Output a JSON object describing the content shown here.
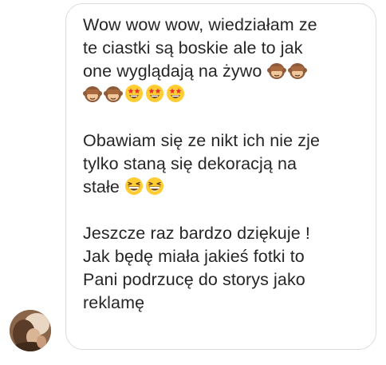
{
  "thread": {
    "message": {
      "paragraphs": [
        {
          "lines": [
            "Wow wow wow, wiedziałam ze",
            "te ciastki są boskie ale to jak",
            "one wyglądają na żywo"
          ],
          "emoji_line_end": [
            "see-no-evil-monkey-icon",
            "see-no-evil-monkey-icon"
          ],
          "emoji_line": [
            "see-no-evil-monkey-icon",
            "see-no-evil-monkey-icon",
            "star-struck-icon",
            "star-struck-icon",
            "star-struck-icon"
          ]
        },
        {
          "lines": [
            "Obawiam się ze nikt ich nie zje",
            "tylko staną się dekoracją na",
            "stałe"
          ],
          "emoji_line_end": [
            "grinning-squinting-icon",
            "grinning-squinting-icon"
          ]
        },
        {
          "lines": [
            "Jeszcze raz bardzo dziękuje !",
            "Jak będę miała jakieś fotki to",
            "Pani podrzucę do storys jako",
            "reklamę"
          ]
        }
      ]
    }
  }
}
